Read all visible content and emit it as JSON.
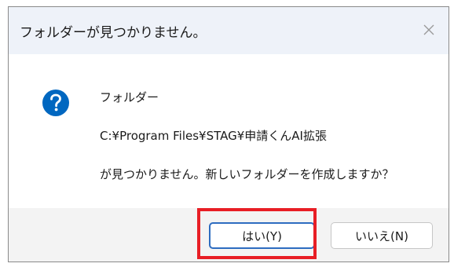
{
  "dialog": {
    "title": "フォルダーが見つかりません。",
    "icon": "question-icon",
    "message": {
      "line1": "フォルダー",
      "line2": "C:¥Program Files¥STAG¥申請くんAI拡張",
      "line3": "が見つかりません。新しいフォルダーを作成しますか？"
    },
    "buttons": {
      "yes_label": "はい(Y)",
      "no_label": "いいえ(N)"
    }
  },
  "colors": {
    "accent": "#0067C0",
    "highlight": "#E81E25",
    "title_bar": "#EEF2F9"
  }
}
